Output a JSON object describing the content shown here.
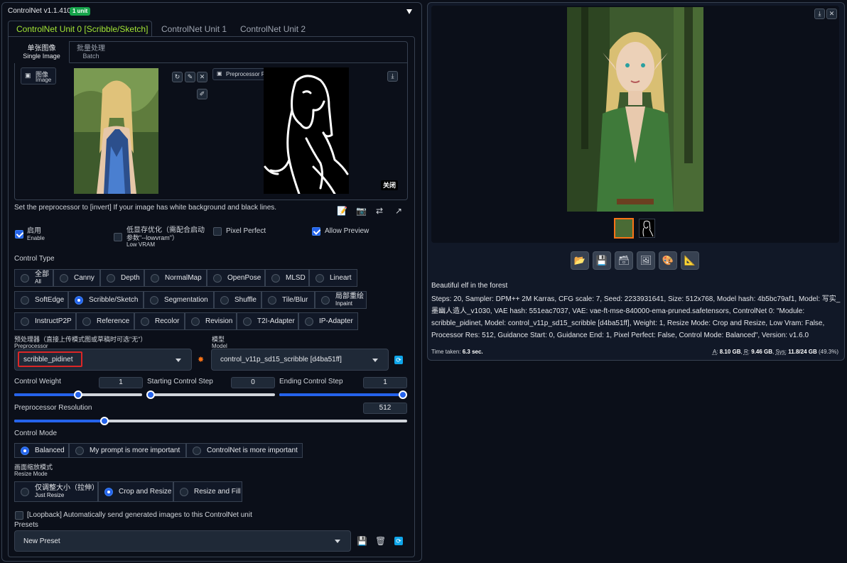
{
  "header": {
    "title": "ControlNet v1.1.410",
    "badge": "1 unit",
    "collapse_icon": "triangle-down"
  },
  "unit_tabs": [
    "ControlNet Unit 0 [Scribble/Sketch]",
    "ControlNet Unit 1",
    "ControlNet Unit 2"
  ],
  "image_tabs": [
    {
      "label": "单张图像",
      "sub": "Single Image"
    },
    {
      "label": "批量处理",
      "sub": "Batch"
    }
  ],
  "image_label": {
    "label": "图像",
    "sub": "Image"
  },
  "preview_label": "Preprocessor Preview",
  "close_button": "关闭",
  "hint": "Set the preprocessor to [invert] If your image has white background and black lines.",
  "options": {
    "enable": {
      "label": "启用",
      "sub": "Enable",
      "checked": true
    },
    "low_vram": {
      "label": "低显存优化（需配合启动",
      "label2": "参数\"--lowvram\"）",
      "sub": "Low VRAM",
      "checked": false
    },
    "pixel_perfect": {
      "label": "Pixel Perfect",
      "checked": false
    },
    "allow_preview": {
      "label": "Allow Preview",
      "checked": true
    }
  },
  "control_type": {
    "title": "Control Type",
    "row1": [
      {
        "label": "全部",
        "sub": "All"
      },
      {
        "label": "Canny"
      },
      {
        "label": "Depth"
      },
      {
        "label": "NormalMap"
      },
      {
        "label": "OpenPose"
      },
      {
        "label": "MLSD"
      },
      {
        "label": "Lineart"
      }
    ],
    "row2": [
      {
        "label": "SoftEdge"
      },
      {
        "label": "Scribble/Sketch",
        "selected": true
      },
      {
        "label": "Segmentation"
      },
      {
        "label": "Shuffle"
      },
      {
        "label": "Tile/Blur"
      },
      {
        "label": "局部重绘",
        "sub": "Inpaint"
      }
    ],
    "row3": [
      {
        "label": "InstructP2P"
      },
      {
        "label": "Reference"
      },
      {
        "label": "Recolor"
      },
      {
        "label": "Revision"
      },
      {
        "label": "T2I-Adapter"
      },
      {
        "label": "IP-Adapter"
      }
    ]
  },
  "preprocessor": {
    "label": "预处理器（直接上传模式图或草稿时可选\"无\"）",
    "sub": "Preprocessor",
    "value": "scribble_pidinet"
  },
  "model": {
    "label": "模型",
    "sub": "Model",
    "value": "control_v11p_sd15_scribble [d4ba51ff]"
  },
  "sliders": {
    "control_weight": {
      "label": "Control Weight",
      "value": "1",
      "fraction": 0.5
    },
    "starting_step": {
      "label": "Starting Control Step",
      "value": "0",
      "fraction": 0.0
    },
    "ending_step": {
      "label": "Ending Control Step",
      "value": "1",
      "fraction": 1.0
    },
    "resolution": {
      "label": "Preprocessor Resolution",
      "value": "512",
      "fraction": 0.23
    }
  },
  "control_mode": {
    "title": "Control Mode",
    "options": [
      {
        "label": "Balanced",
        "selected": true
      },
      {
        "label": "My prompt is more important"
      },
      {
        "label": "ControlNet is more important"
      }
    ]
  },
  "resize_mode": {
    "title": "画面缩放模式",
    "sub": "Resize Mode",
    "options": [
      {
        "label": "仅调整大小（拉伸）",
        "sub": "Just Resize"
      },
      {
        "label": "Crop and Resize",
        "selected": true
      },
      {
        "label": "Resize and Fill"
      }
    ]
  },
  "loopback": "[Loopback] Automatically send generated images to this ControlNet unit",
  "presets": {
    "label": "Presets",
    "value": "New Preset"
  },
  "output": {
    "prompt": "Beautiful elf in the forest",
    "params": "Steps: 20, Sampler: DPM++ 2M Karras, CFG scale: 7, Seed: 2233931641, Size: 512x768, Model hash: 4b5bc79af1, Model: 写实_墨幽人造人_v1030, VAE hash: 551eac7037, VAE: vae-ft-mse-840000-ema-pruned.safetensors, ControlNet 0: \"Module: scribble_pidinet, Model: control_v11p_sd15_scribble [d4ba51ff], Weight: 1, Resize Mode: Crop and Resize, Low Vram: False, Processor Res: 512, Guidance Start: 0, Guidance End: 1, Pixel Perfect: False, Control Mode: Balanced\", Version: v1.6.0",
    "time_label": "Time taken:",
    "time_value": "6.3 sec.",
    "vram_a_label": "A:",
    "vram_a": "8.10 GB",
    "vram_r_label": "R:",
    "vram_r": "9.46 GB",
    "vram_sys_label": "Sys:",
    "vram_sys": "11.8/24 GB",
    "vram_pct": "(49.3%)"
  },
  "icons": [
    "folder-icon",
    "save-icon",
    "zip-icon",
    "image-icon",
    "palette-icon",
    "ruler-icon"
  ],
  "colors": {
    "accent": "#2563eb",
    "tab_active": "#a3e635",
    "badge": "#16a34a",
    "highlight_box": "#dc2626"
  }
}
